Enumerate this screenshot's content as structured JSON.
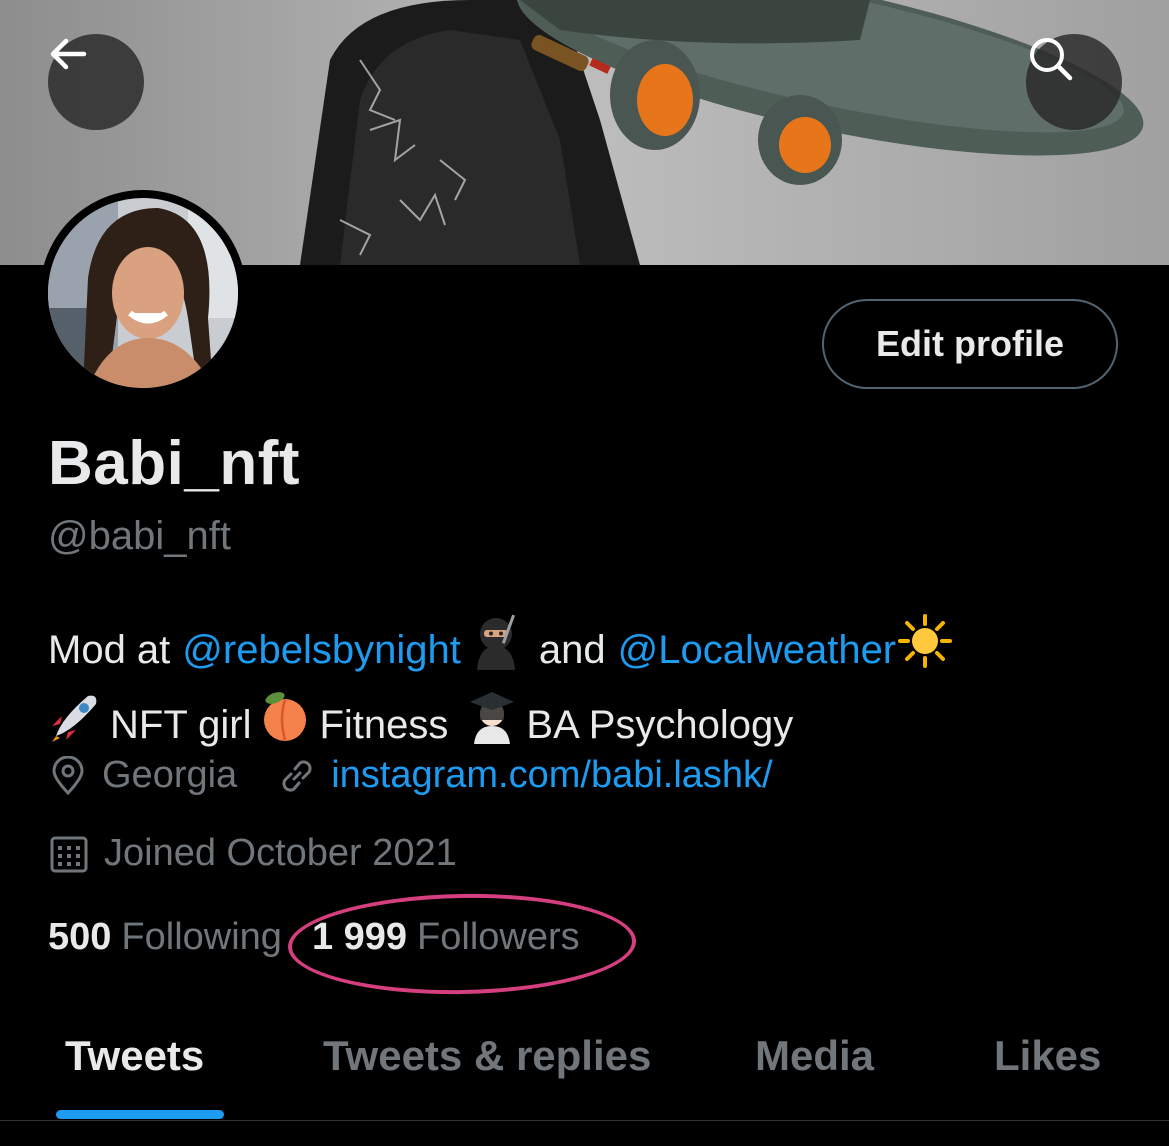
{
  "header": {
    "back_icon": "arrow-left-icon",
    "search_icon": "search-icon",
    "edit_profile_label": "Edit profile"
  },
  "profile": {
    "display_name": "Babi_nft",
    "handle": "@babi_nft",
    "bio": {
      "line1_prefix": "Mod at",
      "mention1": "@rebelsbynight",
      "line1_middle": "and",
      "mention2": "@Localweather",
      "line2_part1": "NFT girl",
      "line2_part2": "Fitness",
      "line2_part3": "BA Psychology"
    },
    "location": "Georgia",
    "website": "instagram.com/babi.lashk/",
    "joined": "Joined October 2021",
    "following_count": "500",
    "following_label": "Following",
    "followers_count": "1 999",
    "followers_label": "Followers"
  },
  "tabs": [
    {
      "label": "Tweets",
      "active": true
    },
    {
      "label": "Tweets & replies",
      "active": false
    },
    {
      "label": "Media",
      "active": false
    },
    {
      "label": "Likes",
      "active": false
    }
  ],
  "colors": {
    "accent": "#1d9bf0",
    "muted": "#71767b",
    "highlight_circle": "#d63f7f"
  }
}
